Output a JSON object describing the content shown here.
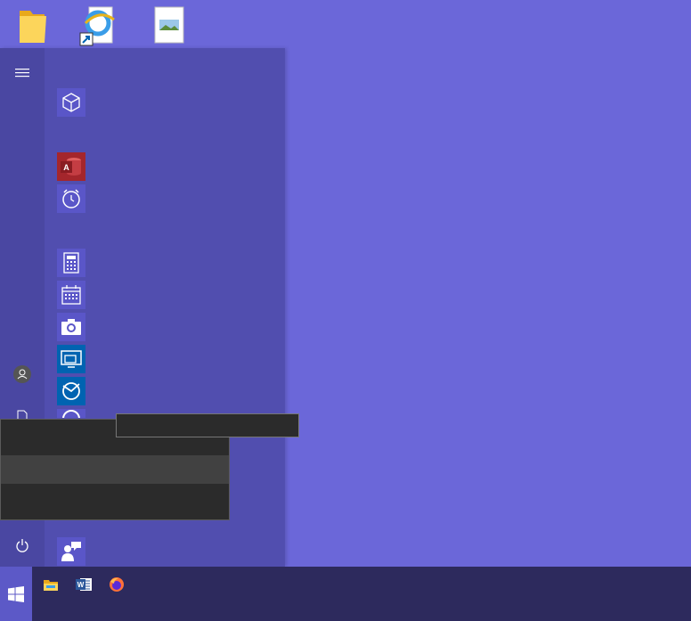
{
  "desktop": {
    "icons": [
      {
        "name": "folder-icon"
      },
      {
        "name": "internet-explorer-icon"
      },
      {
        "name": "image-file-icon"
      }
    ]
  },
  "start_menu": {
    "rail": [
      "hamburger-icon",
      "user-icon",
      "document-icon",
      "power-icon"
    ],
    "tiles": [
      {
        "icon": "3d-viewer-icon",
        "label": "",
        "bg": "#5a56c8"
      },
      {
        "icon": "access-icon",
        "label": "",
        "bg": "#a4262c"
      },
      {
        "icon": "alarms-icon",
        "label": "",
        "bg": "#5a56c8"
      },
      {
        "icon": "calculator-icon",
        "label": "",
        "bg": "#5a56c8"
      },
      {
        "icon": "calendar-icon",
        "label": "",
        "bg": "#5a56c8"
      },
      {
        "icon": "camera-icon",
        "label": "",
        "bg": "#5a56c8"
      },
      {
        "icon": "connect-icon",
        "label": "",
        "bg": "#0063b1"
      },
      {
        "icon": "cortana-feedback-icon",
        "label": "",
        "bg": "#0063b1"
      },
      {
        "icon": "app-icon",
        "label": "",
        "bg": "#5a56c8"
      },
      {
        "icon": "contact-support-icon",
        "label": "",
        "bg": "#5a56c8"
      }
    ]
  },
  "context_menu": {
    "items": [
      "",
      "",
      ""
    ]
  },
  "tooltip": {
    "text": ""
  },
  "taskbar": {
    "items": [
      "file-explorer-icon",
      "word-icon",
      "firefox-icon"
    ]
  }
}
